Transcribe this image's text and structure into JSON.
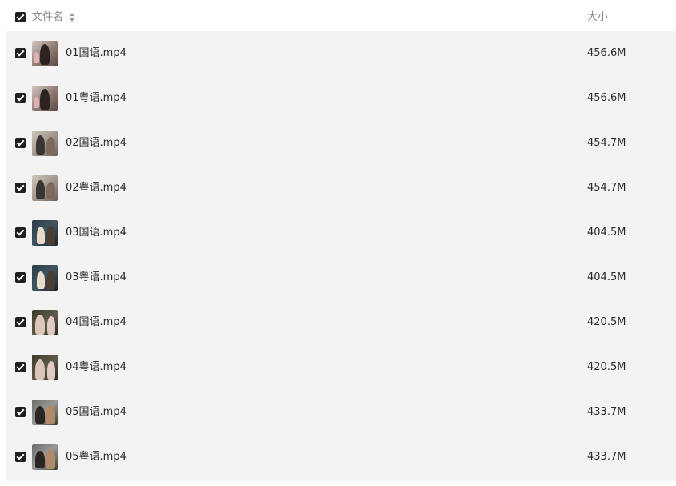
{
  "header": {
    "name_label": "文件名",
    "size_label": "大小",
    "sort_icon": "sort-icon"
  },
  "files": [
    {
      "name": "01国语.mp4",
      "size": "456.6M",
      "thumb": "t1"
    },
    {
      "name": "01粤语.mp4",
      "size": "456.6M",
      "thumb": "t1"
    },
    {
      "name": "02国语.mp4",
      "size": "454.7M",
      "thumb": "t2"
    },
    {
      "name": "02粤语.mp4",
      "size": "454.7M",
      "thumb": "t2"
    },
    {
      "name": "03国语.mp4",
      "size": "404.5M",
      "thumb": "t3"
    },
    {
      "name": "03粤语.mp4",
      "size": "404.5M",
      "thumb": "t3"
    },
    {
      "name": "04国语.mp4",
      "size": "420.5M",
      "thumb": "t4"
    },
    {
      "name": "04粤语.mp4",
      "size": "420.5M",
      "thumb": "t4"
    },
    {
      "name": "05国语.mp4",
      "size": "433.7M",
      "thumb": "t5"
    },
    {
      "name": "05粤语.mp4",
      "size": "433.7M",
      "thumb": "t5"
    }
  ],
  "colors": {
    "checkbox": "#1f1f24",
    "list_background": "#f3f3f3",
    "header_text": "#8a8a8a",
    "row_text": "#2b2b2b"
  }
}
